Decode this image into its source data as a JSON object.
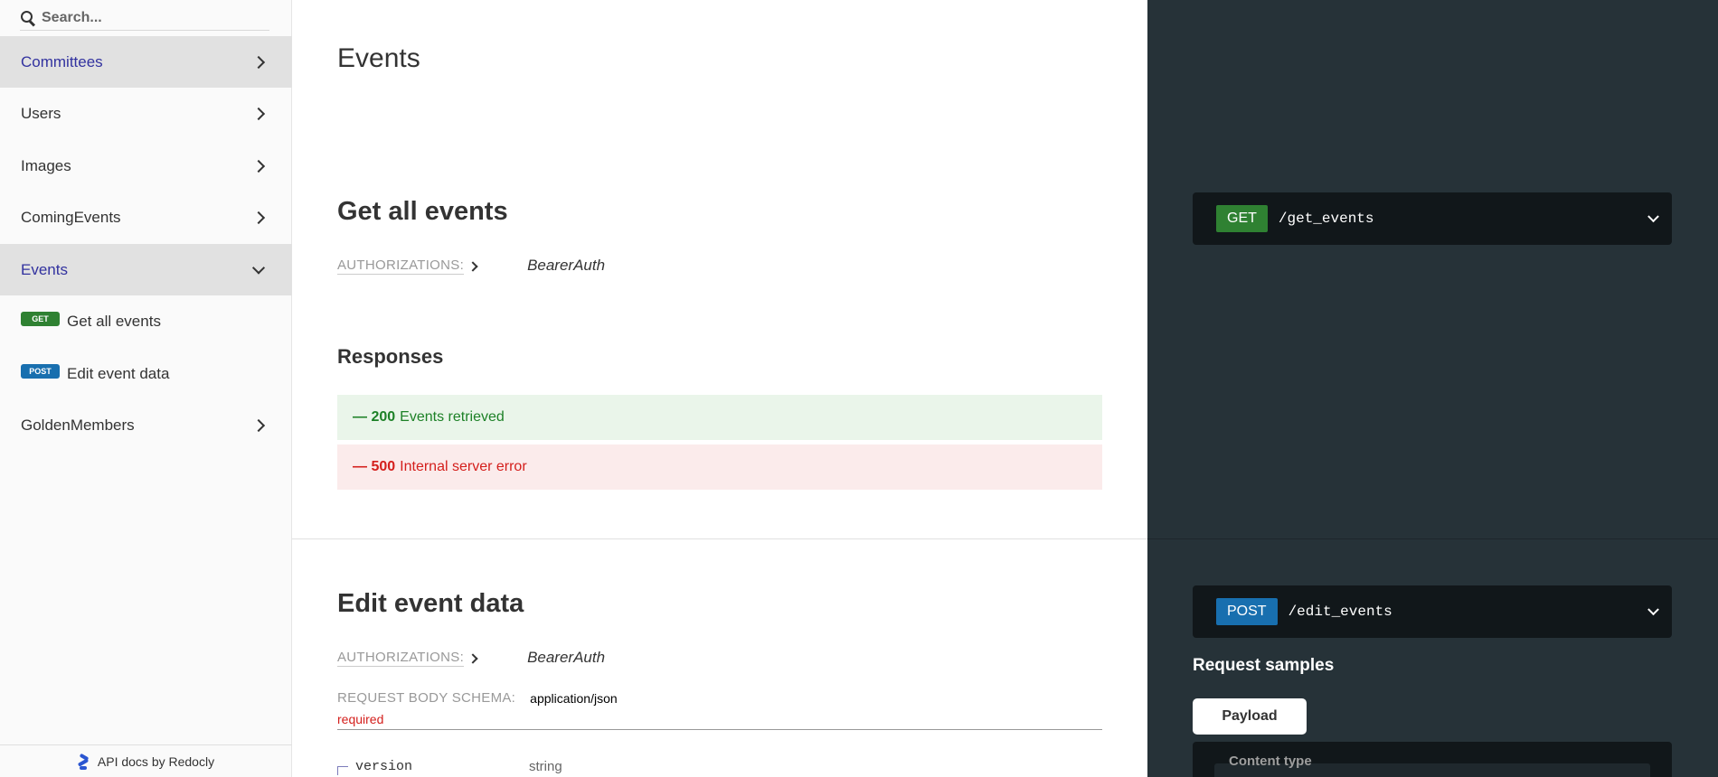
{
  "sidebar": {
    "search_placeholder": "Search...",
    "items": [
      {
        "label": "Committees"
      },
      {
        "label": "Users"
      },
      {
        "label": "Images"
      },
      {
        "label": "ComingEvents"
      },
      {
        "label": "Events"
      },
      {
        "label": "GoldenMembers"
      }
    ],
    "sub_items": [
      {
        "method": "GET",
        "label": "Get all events"
      },
      {
        "method": "POST",
        "label": "Edit event data"
      }
    ],
    "footer": "API docs by Redocly"
  },
  "main": {
    "section_title": "Events",
    "op1": {
      "title": "Get all events",
      "auth_label": "AUTHORIZATIONS:",
      "auth_value": "BearerAuth",
      "responses_title": "Responses",
      "responses": [
        {
          "dash": "—",
          "code": "200",
          "text": "Events retrieved"
        },
        {
          "dash": "—",
          "code": "500",
          "text": "Internal server error"
        }
      ]
    },
    "op2": {
      "title": "Edit event data",
      "auth_label": "AUTHORIZATIONS:",
      "auth_value": "BearerAuth",
      "schema_label": "REQUEST BODY SCHEMA:",
      "schema_value": "application/json",
      "required": "required",
      "prop_name": "version",
      "prop_type": "string"
    }
  },
  "right": {
    "ep1": {
      "method": "GET",
      "path": "/get_events"
    },
    "ep2": {
      "method": "POST",
      "path": "/edit_events"
    },
    "samples_title": "Request samples",
    "tab_label": "Payload",
    "content_type": "Content type"
  },
  "colors": {
    "accent": "#32329f",
    "get": "#2f8132",
    "post": "#186faf",
    "success": "#1d8127",
    "error": "#d41f1c",
    "dark_panel": "#263238"
  }
}
